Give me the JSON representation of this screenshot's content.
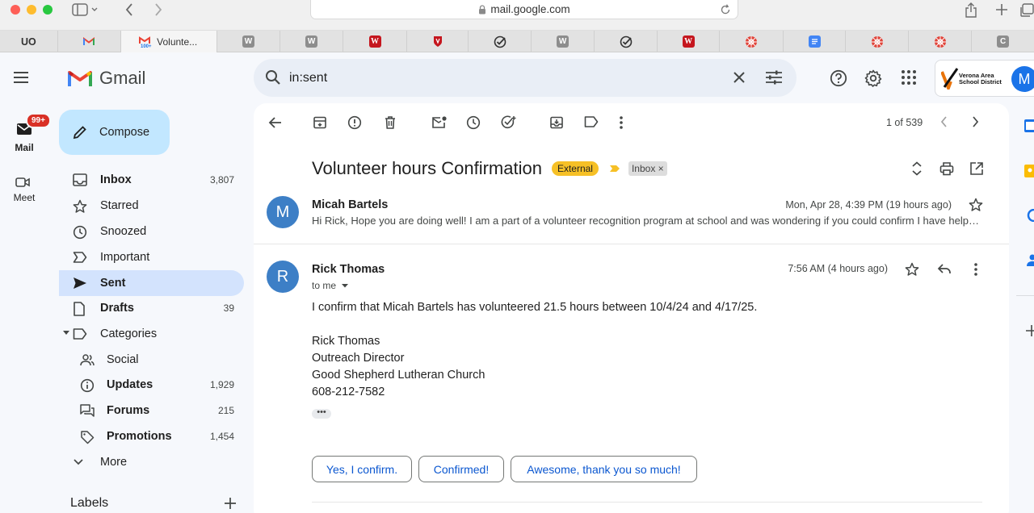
{
  "browser": {
    "url": "mail.google.com",
    "tabs": [
      {
        "label": "UO"
      },
      {
        "label": ""
      },
      {
        "label": "Volunte..."
      }
    ],
    "w_letter": "W",
    "c_letter": "C"
  },
  "rail": {
    "badge": "99+",
    "mail_label": "Mail",
    "meet_label": "Meet"
  },
  "gmail": {
    "logo_text": "Gmail",
    "compose_label": "Compose",
    "nav": [
      {
        "label": "Inbox",
        "count": "3,807"
      },
      {
        "label": "Starred",
        "count": ""
      },
      {
        "label": "Snoozed",
        "count": ""
      },
      {
        "label": "Important",
        "count": ""
      },
      {
        "label": "Sent",
        "count": ""
      },
      {
        "label": "Drafts",
        "count": "39"
      },
      {
        "label": "Categories",
        "count": ""
      },
      {
        "label": "Social",
        "count": ""
      },
      {
        "label": "Updates",
        "count": "1,929"
      },
      {
        "label": "Forums",
        "count": "215"
      },
      {
        "label": "Promotions",
        "count": "1,454"
      },
      {
        "label": "More",
        "count": ""
      }
    ],
    "labels_heading": "Labels"
  },
  "search": {
    "value": "in:sent"
  },
  "org": {
    "name_line1": "Verona Area",
    "name_line2": "School District",
    "avatar_letter": "M"
  },
  "toolbar": {
    "pager": "1 of 539"
  },
  "thread": {
    "subject": "Volunteer hours Confirmation",
    "external_label": "External",
    "inbox_label": "Inbox ×",
    "messages": [
      {
        "initial": "M",
        "sender": "Micah Bartels",
        "date": "Mon, Apr 28, 4:39 PM (19 hours ago)",
        "snippet": "Hi Rick, Hope you are doing well! I am a part of a volunteer recognition program at school and was wondering if you could confirm I have helped out at Good Shepherd Lutheran Church"
      },
      {
        "initial": "R",
        "sender": "Rick Thomas",
        "date": "7:56 AM (4 hours ago)",
        "to": "to me",
        "body": "I confirm that Micah Bartels has volunteered 21.5 hours between 10/4/24 and 4/17/25.",
        "signature": [
          "Rick Thomas",
          "Outreach Director",
          "Good Shepherd Lutheran Church",
          "608-212-7582"
        ],
        "ellipsis": "•••"
      }
    ],
    "smart_replies": [
      "Yes, I confirm.",
      "Confirmed!",
      "Awesome, thank you so much!"
    ]
  },
  "colors": {
    "accent": "#0b57d0",
    "compose_bg": "#c2e7ff",
    "active_nav": "#d3e3fd",
    "external_chip": "#f6c026",
    "badge": "#d93025"
  }
}
